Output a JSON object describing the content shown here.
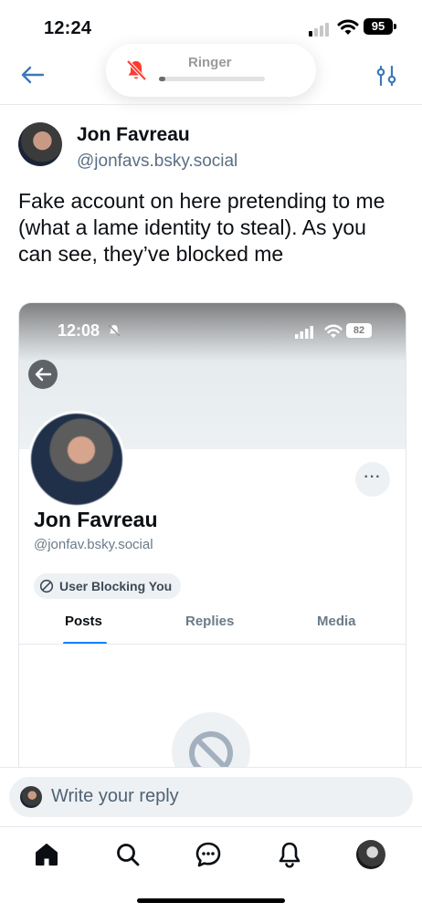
{
  "status_bar": {
    "time": "12:24",
    "battery": "95"
  },
  "ringer": {
    "label": "Ringer",
    "level": 0.06
  },
  "post": {
    "author_name": "Jon Favreau",
    "author_handle": "@jonfavs.bsky.social",
    "text": "Fake account on here pretending to me (what a lame identity to steal). As you can see, they’ve blocked me"
  },
  "embed": {
    "time": "12:08",
    "battery": "82",
    "more": "···",
    "name": "Jon Favreau",
    "handle": "@jonfav.bsky.social",
    "badge": "User Blocking You",
    "tabs": [
      {
        "label": "Posts"
      },
      {
        "label": "Replies"
      },
      {
        "label": "Media"
      }
    ]
  },
  "reply": {
    "placeholder": "Write your reply"
  },
  "nav": {
    "items": [
      "home-icon",
      "search-icon",
      "chat-icon",
      "bell-icon",
      "profile-avatar"
    ]
  },
  "colors": {
    "accent": "#1083fe",
    "back_arrow": "#3d78b8",
    "muted": "#5a6f84"
  }
}
